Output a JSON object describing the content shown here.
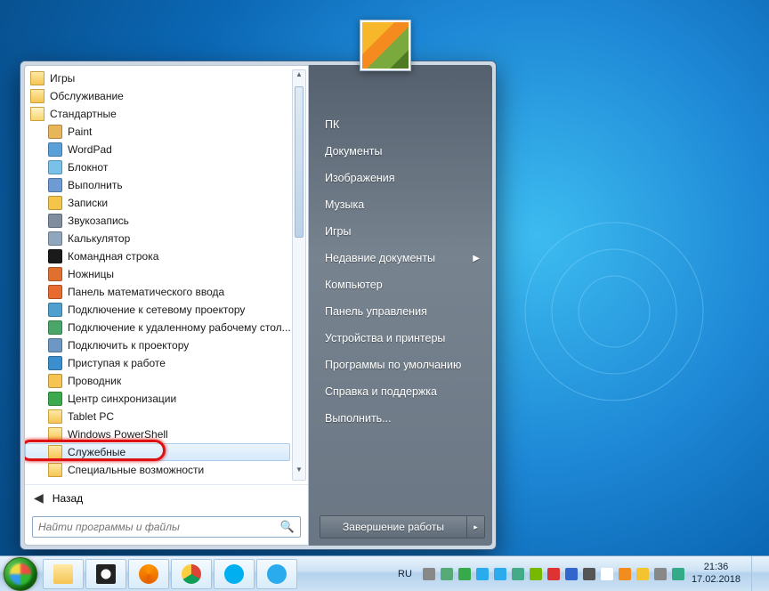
{
  "startmenu": {
    "programs": [
      {
        "label": "Игры",
        "depth": 0,
        "type": "folder"
      },
      {
        "label": "Обслуживание",
        "depth": 0,
        "type": "folder"
      },
      {
        "label": "Стандартные",
        "depth": 0,
        "type": "folder-open"
      },
      {
        "label": "Paint",
        "depth": 1,
        "icon": "paint"
      },
      {
        "label": "WordPad",
        "depth": 1,
        "icon": "wordpad"
      },
      {
        "label": "Блокнот",
        "depth": 1,
        "icon": "notepad"
      },
      {
        "label": "Выполнить",
        "depth": 1,
        "icon": "run"
      },
      {
        "label": "Записки",
        "depth": 1,
        "icon": "sticky"
      },
      {
        "label": "Звукозапись",
        "depth": 1,
        "icon": "mic"
      },
      {
        "label": "Калькулятор",
        "depth": 1,
        "icon": "calc"
      },
      {
        "label": "Командная строка",
        "depth": 1,
        "icon": "cmd"
      },
      {
        "label": "Ножницы",
        "depth": 1,
        "icon": "snip"
      },
      {
        "label": "Панель математического ввода",
        "depth": 1,
        "icon": "math"
      },
      {
        "label": "Подключение к сетевому проектору",
        "depth": 1,
        "icon": "netproj"
      },
      {
        "label": "Подключение к удаленному рабочему стол...",
        "depth": 1,
        "icon": "rdp"
      },
      {
        "label": "Подключить к проектору",
        "depth": 1,
        "icon": "proj"
      },
      {
        "label": "Приступая к работе",
        "depth": 1,
        "icon": "start"
      },
      {
        "label": "Проводник",
        "depth": 1,
        "icon": "explorer"
      },
      {
        "label": "Центр синхронизации",
        "depth": 1,
        "icon": "sync"
      },
      {
        "label": "Tablet PC",
        "depth": 1,
        "type": "folder"
      },
      {
        "label": "Windows PowerShell",
        "depth": 1,
        "type": "folder"
      },
      {
        "label": "Служебные",
        "depth": 1,
        "type": "folder",
        "selected": true,
        "highlight": true
      },
      {
        "label": "Специальные возможности",
        "depth": 1,
        "type": "folder"
      }
    ],
    "back_label": "Назад",
    "search_placeholder": "Найти программы и файлы",
    "right": [
      {
        "label": "ПК"
      },
      {
        "label": "Документы"
      },
      {
        "label": "Изображения"
      },
      {
        "label": "Музыка"
      },
      {
        "label": "Игры"
      },
      {
        "label": "Недавние документы",
        "submenu": true
      },
      {
        "label": "Компьютер"
      },
      {
        "label": "Панель управления"
      },
      {
        "label": "Устройства и принтеры"
      },
      {
        "label": "Программы по умолчанию"
      },
      {
        "label": "Справка и поддержка"
      },
      {
        "label": "Выполнить..."
      }
    ],
    "shutdown_label": "Завершение работы"
  },
  "taskbar": {
    "lang": "RU",
    "time": "21:36",
    "date": "17.02.2018",
    "pinned": [
      {
        "name": "explorer",
        "bg": "linear-gradient(#ffe9a6,#f5c452)"
      },
      {
        "name": "panda",
        "bg": "radial-gradient(circle,#fff 35%,#222 36%)"
      },
      {
        "name": "firefox",
        "bg": "conic-gradient(#ff9500,#e66000,#ff9500)"
      },
      {
        "name": "chrome",
        "bg": "conic-gradient(#db4437 0 33%,#0f9d58 33% 66%,#ffcd40 66% 100%)"
      },
      {
        "name": "skype",
        "bg": "#00aff0"
      },
      {
        "name": "telegram",
        "bg": "#2aabee"
      }
    ],
    "tray_icons": [
      "keyboard",
      "chevron",
      "safe",
      "action",
      "telegram",
      "vpn",
      "nvidia",
      "audio",
      "core",
      "net",
      "flag",
      "realtek",
      "yandex",
      "vol",
      "net2"
    ]
  },
  "icon_colors": {
    "paint": "#e8b65a",
    "wordpad": "#5aa0d8",
    "notepad": "#79c1e8",
    "run": "#6d9bd4",
    "sticky": "#f3c64b",
    "mic": "#7e8ea0",
    "calc": "#8fa6bc",
    "cmd": "#1a1a1a",
    "snip": "#e07030",
    "math": "#e76a2e",
    "netproj": "#4f9fcf",
    "rdp": "#4aa569",
    "proj": "#6d97c4",
    "start": "#3c8fce",
    "explorer": "#f5c452",
    "sync": "#3caa4c"
  }
}
